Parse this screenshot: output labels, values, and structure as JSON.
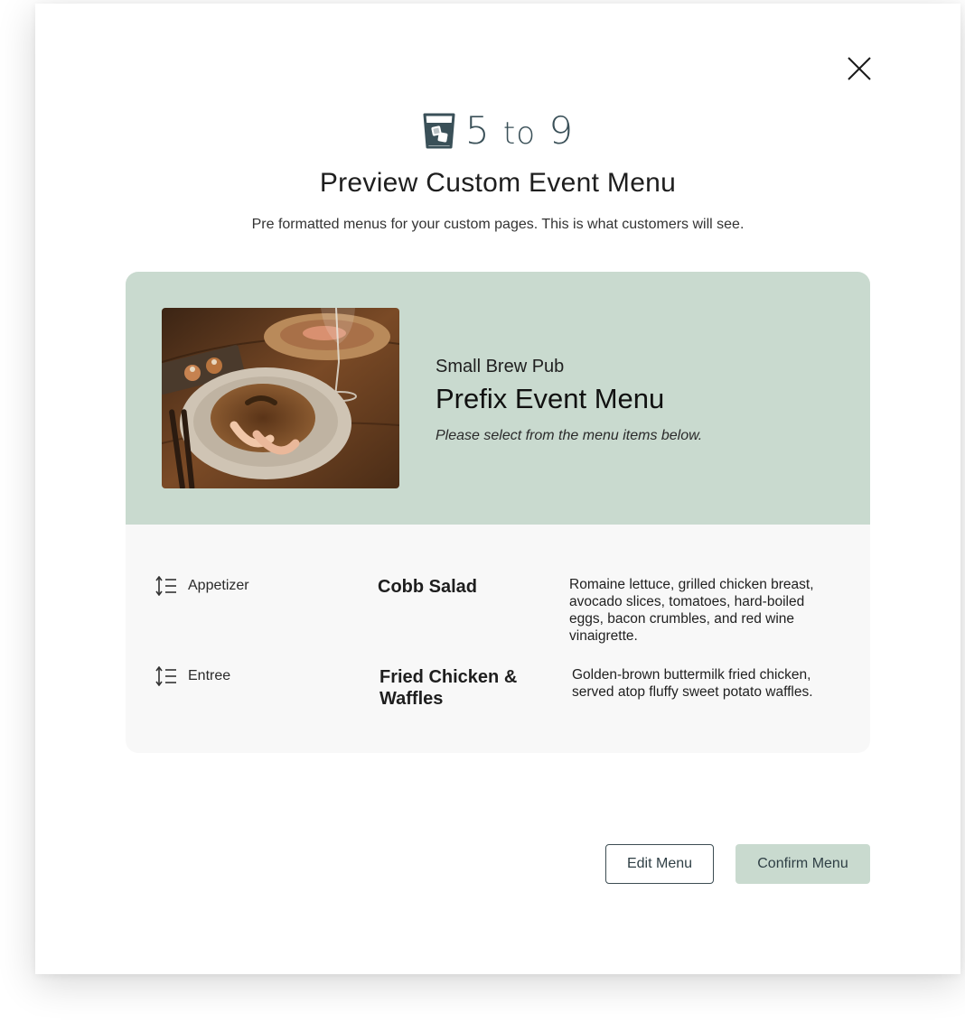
{
  "header": {
    "brand_name": "5 to 9",
    "brand_number_left": "5",
    "brand_word": "to",
    "brand_number_right": "9",
    "title": "Preview Custom Event Menu",
    "subtitle": "Pre formatted menus for your custom pages. This is what customers will see."
  },
  "menu": {
    "restaurant": "Small Brew Pub",
    "title": "Prefix Event Menu",
    "note": "Please select from the menu items below.",
    "items": [
      {
        "course": "Appetizer",
        "name": "Cobb Salad",
        "description": "Romaine lettuce, grilled chicken breast, avocado slices, tomatoes, hard-boiled eggs, bacon crumbles, and red wine vinaigrette."
      },
      {
        "course": "Entree",
        "name": "Fried Chicken & Waffles",
        "description": "Golden-brown buttermilk fried chicken, served atop fluffy sweet potato waffles."
      }
    ]
  },
  "actions": {
    "edit_label": "Edit Menu",
    "confirm_label": "Confirm Menu"
  },
  "colors": {
    "accent": "#c9dacf",
    "brand": "#3a5058",
    "card_body": "#f8f8f8"
  },
  "icons": [
    "close-icon",
    "glass-logo-icon",
    "reorder-icon"
  ]
}
